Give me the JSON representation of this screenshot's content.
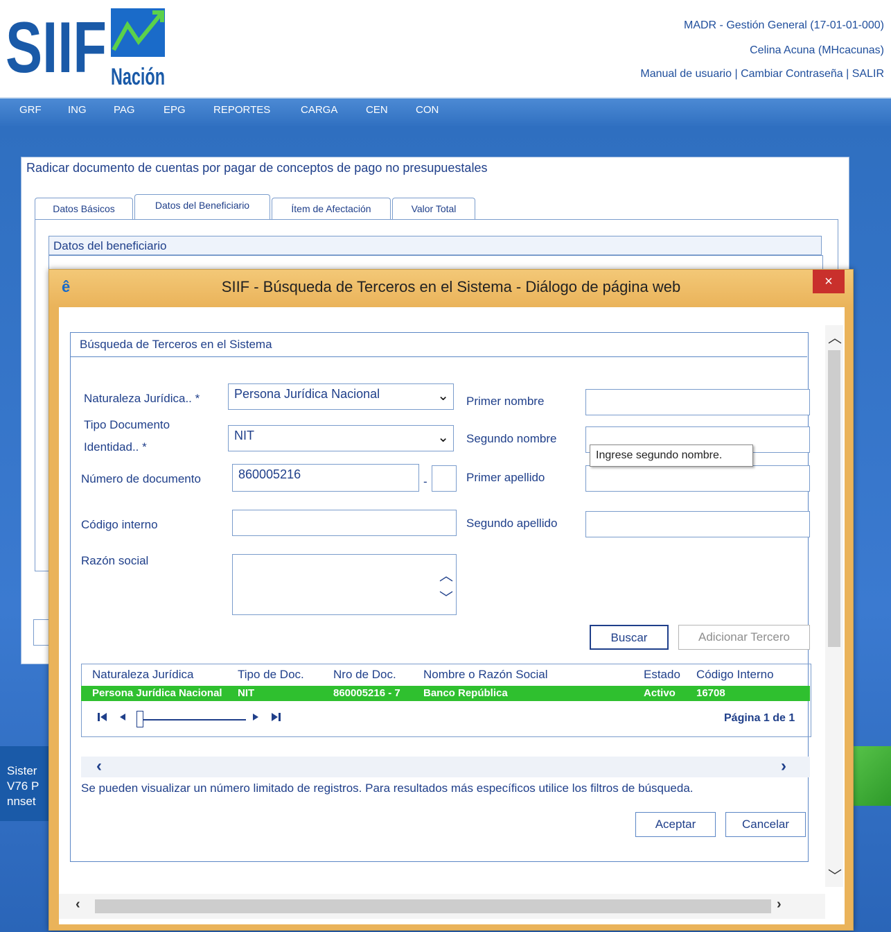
{
  "header": {
    "logo_text": "SIIF",
    "logo_sub": "Nación",
    "entity": "MADR - Gestión General (17-01-01-000)",
    "user": "Celina Acuna (MHcacunas)",
    "links": [
      "Manual de usuario",
      "Cambiar Contraseña",
      "SALIR"
    ],
    "separator": "|"
  },
  "menu": [
    "GRF",
    "ING",
    "PAG",
    "EPG",
    "REPORTES",
    "CARGA",
    "CEN",
    "CON"
  ],
  "page": {
    "title": "Radicar documento de cuentas por pagar de conceptos de pago no presupuestales",
    "tabs": [
      "Datos Básicos",
      "Datos del Beneficiario",
      "Ítem de Afectación",
      "Valor Total"
    ],
    "section_title": "Datos del beneficiario"
  },
  "footer": {
    "line1": "Sister",
    "line2": "V76 P",
    "line3": "nnset"
  },
  "dialog": {
    "title": "SIIF - Búsqueda de Terceros en el Sistema - Diálogo de página web",
    "close": "×",
    "panel_title": "Búsqueda de Terceros en el Sistema",
    "labels": {
      "naturaleza": "Naturaleza Jurídica.. *",
      "tipo_doc_1": "Tipo Documento",
      "tipo_doc_2": "Identidad.. *",
      "numero_doc": "Número de documento",
      "codigo_interno": "Código interno",
      "razon_social": "Razón social",
      "primer_nombre": "Primer nombre",
      "segundo_nombre": "Segundo nombre",
      "primer_apellido": "Primer apellido",
      "segundo_apellido": "Segundo apellido"
    },
    "values": {
      "naturaleza": "Persona Jurídica Nacional",
      "tipo_doc": "NIT",
      "numero_doc": "860005216",
      "dv": "",
      "dash": "-",
      "codigo_interno": "",
      "razon_social": "",
      "primer_nombre": "",
      "segundo_nombre": "",
      "primer_apellido": "",
      "segundo_apellido": ""
    },
    "tooltip": "Ingrese segundo nombre.",
    "buttons": {
      "buscar": "Buscar",
      "adicionar": "Adicionar Tercero",
      "aceptar": "Aceptar",
      "cancelar": "Cancelar"
    },
    "table": {
      "headers": [
        "Naturaleza Jurídica",
        "Tipo de Doc.",
        "Nro de Doc.",
        "Nombre o Razón Social",
        "Estado",
        "Código Interno"
      ],
      "rows": [
        [
          "Persona Jurídica Nacional",
          "NIT",
          "860005216 - 7",
          "Banco República",
          "Activo",
          "16708"
        ]
      ]
    },
    "pager": {
      "first": "⏮",
      "prev": "◀",
      "next": "▶",
      "last": "⏭",
      "info": "Página 1 de 1"
    },
    "info_message": "Se pueden visualizar un número limitado de registros. Para resultados más específicos utilice los filtros de búsqueda.",
    "colors": {
      "selected_row": "#2fc02f",
      "titlebar": "#eab35a",
      "close": "#c9302c",
      "text": "#1f3f8a"
    }
  }
}
